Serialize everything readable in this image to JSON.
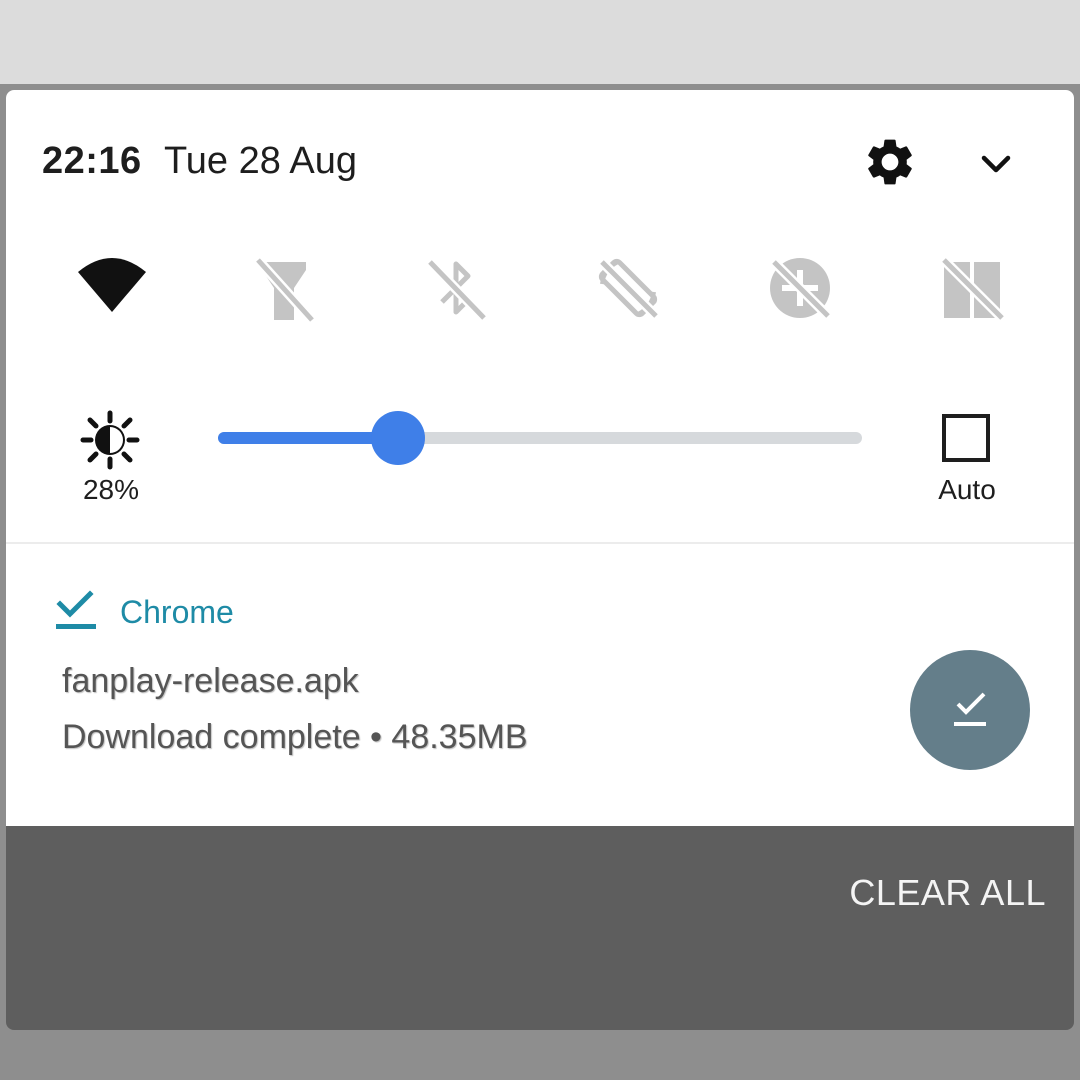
{
  "header": {
    "time": "22:16",
    "date": "Tue 28 Aug",
    "settings_icon": "gear-icon",
    "expand_icon": "chevron-down-icon"
  },
  "quick_settings": [
    {
      "name": "wifi",
      "icon": "wifi-icon",
      "state": "on"
    },
    {
      "name": "flashlight",
      "icon": "flashlight-off-icon",
      "state": "off"
    },
    {
      "name": "bluetooth",
      "icon": "bluetooth-off-icon",
      "state": "off"
    },
    {
      "name": "auto-rotate",
      "icon": "auto-rotate-off-icon",
      "state": "off"
    },
    {
      "name": "data-saver",
      "icon": "data-saver-off-icon",
      "state": "off"
    },
    {
      "name": "mobile-data",
      "icon": "mobile-data-off-icon",
      "state": "off"
    }
  ],
  "brightness": {
    "percent_label": "28%",
    "level": 0.28,
    "auto_label": "Auto",
    "auto_checked": false
  },
  "notification": {
    "app_name": "Chrome",
    "title": "fanplay-release.apk",
    "text": "Download complete • 48.35MB",
    "app_icon": "download-done-icon",
    "action_icon": "download-done-icon"
  },
  "clear_all_label": "CLEAR ALL",
  "colors": {
    "accent": "#3f7fe8",
    "app_name": "#1e8ba6",
    "inactive_icon": "#c4c4c4",
    "action_bg": "#647e8a",
    "shade_bg": "#5e5e5e"
  }
}
